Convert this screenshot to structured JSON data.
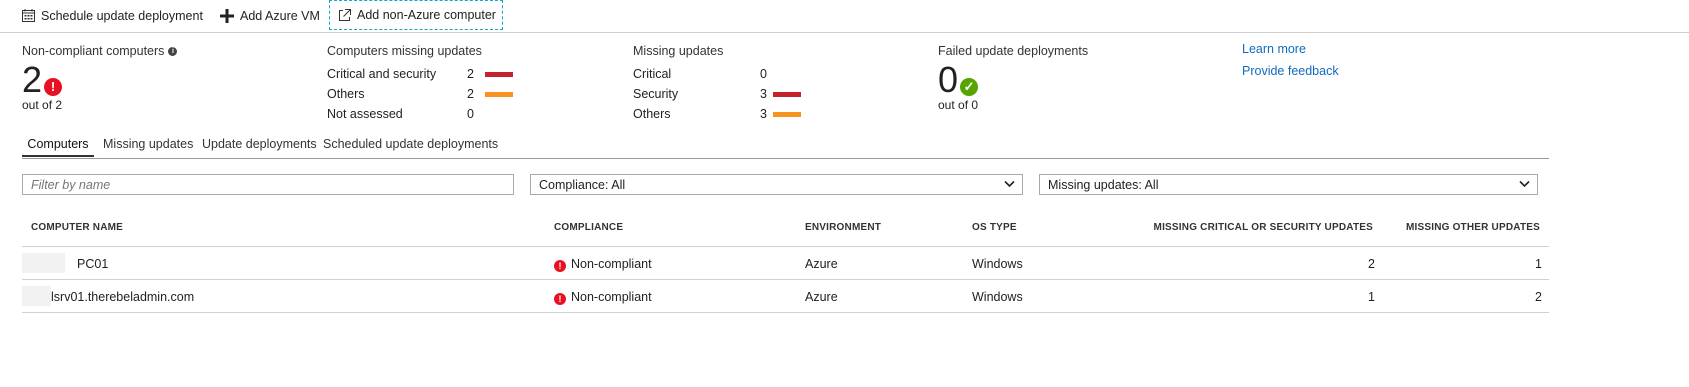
{
  "toolbar": {
    "schedule_label": "Schedule update deployment",
    "add_vm_label": "Add Azure VM",
    "add_non_azure_label": "Add non-Azure computer"
  },
  "summary": {
    "noncompliant": {
      "title": "Non-compliant computers",
      "count": "2",
      "status_icon": "!",
      "sub": "out of 2"
    },
    "computers_missing": {
      "title": "Computers missing updates",
      "rows": [
        {
          "label": "Critical and security",
          "value": "2",
          "bar": "red"
        },
        {
          "label": "Others",
          "value": "2",
          "bar": "orange"
        },
        {
          "label": "Not assessed",
          "value": "0",
          "bar": ""
        }
      ]
    },
    "missing_updates": {
      "title": "Missing updates",
      "rows": [
        {
          "label": "Critical",
          "value": "0",
          "bar": ""
        },
        {
          "label": "Security",
          "value": "3",
          "bar": "red"
        },
        {
          "label": "Others",
          "value": "3",
          "bar": "orange"
        }
      ]
    },
    "failed": {
      "title": "Failed update deployments",
      "count": "0",
      "status_icon": "✓",
      "sub": "out of 0"
    },
    "links": {
      "learn_more": "Learn more",
      "feedback": "Provide feedback"
    }
  },
  "tabs": [
    {
      "label": "Computers",
      "active": true
    },
    {
      "label": "Missing updates",
      "active": false
    },
    {
      "label": "Update deployments",
      "active": false
    },
    {
      "label": "Scheduled update deployments",
      "active": false
    }
  ],
  "filters": {
    "name_placeholder": "Filter by name",
    "compliance": "Compliance: All",
    "missing": "Missing updates: All"
  },
  "table": {
    "headers": {
      "name": "COMPUTER NAME",
      "compliance": "COMPLIANCE",
      "environment": "ENVIRONMENT",
      "os": "OS TYPE",
      "critical": "MISSING CRITICAL OR SECURITY UPDATES",
      "other": "MISSING OTHER UPDATES"
    },
    "rows": [
      {
        "name": "PC01",
        "compliance": "Non-compliant",
        "environment": "Azure",
        "os": "Windows",
        "critical": "2",
        "other": "1"
      },
      {
        "name": "lsrv01.therebeladmin.com",
        "compliance": "Non-compliant",
        "environment": "Azure",
        "os": "Windows",
        "critical": "1",
        "other": "2"
      }
    ]
  },
  "colors": {
    "error": "#e81123",
    "success": "#57a300",
    "bar_red": "#c4232d",
    "bar_orange": "#f7931e",
    "link": "#0f6cbd"
  }
}
